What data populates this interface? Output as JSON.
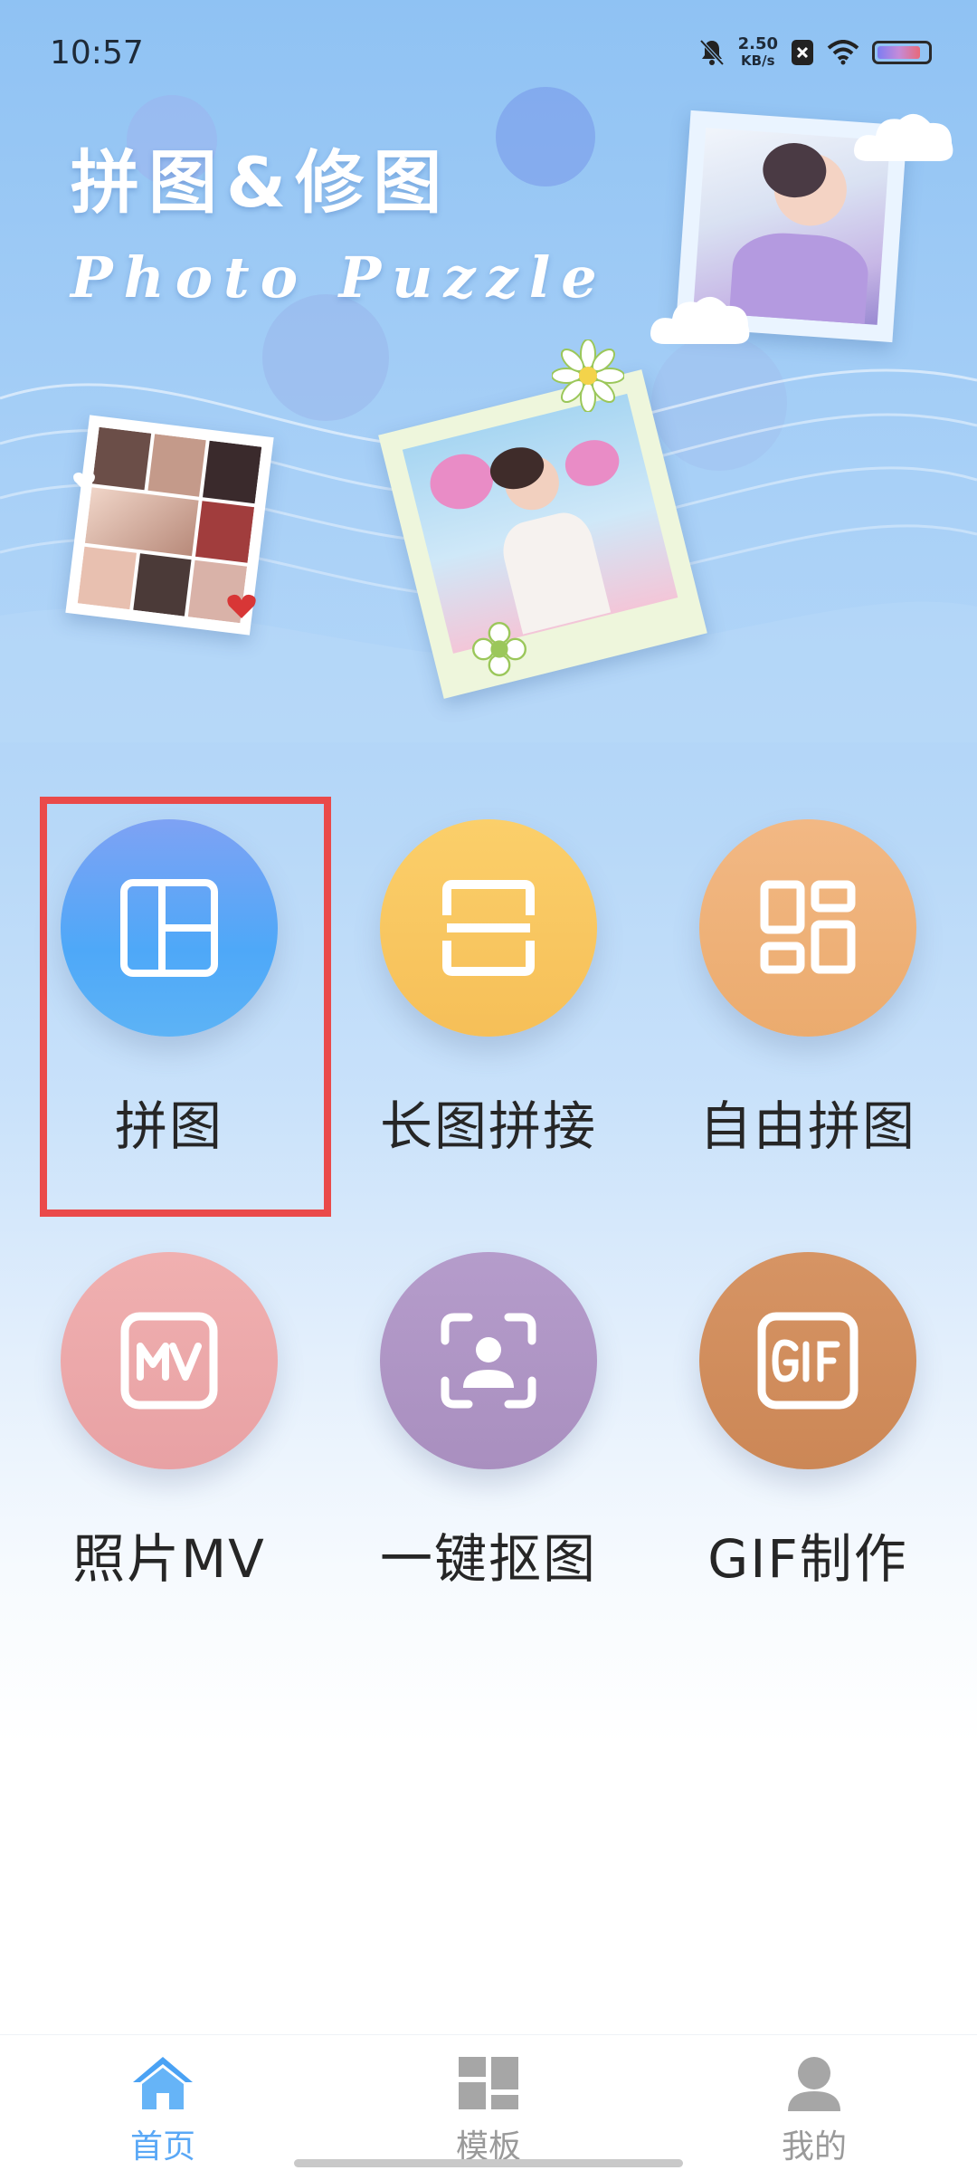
{
  "status_bar": {
    "time": "10:57",
    "net_speed_value": "2.50",
    "net_speed_unit": "KB/s",
    "icons": [
      "bell-muted-icon",
      "x-badge-icon",
      "wifi-icon",
      "battery-icon"
    ]
  },
  "banner": {
    "title": "拼图&修图",
    "subtitle": "Photo Puzzle"
  },
  "features": [
    {
      "label": "拼图",
      "icon": "grid-layout-icon",
      "color": "#5aa8f6"
    },
    {
      "label": "长图拼接",
      "icon": "long-image-stitch-icon",
      "color": "#f6c15c"
    },
    {
      "label": "自由拼图",
      "icon": "free-collage-icon",
      "color": "#efb27a"
    },
    {
      "label": "照片MV",
      "icon": "mv-icon",
      "color": "#eba8a8"
    },
    {
      "label": "一键抠图",
      "icon": "face-scan-icon",
      "color": "#ae94c2"
    },
    {
      "label": "GIF制作",
      "icon": "gif-icon",
      "color": "#d28e5e"
    }
  ],
  "tabs": [
    {
      "label": "首页",
      "icon": "home-icon",
      "active": true,
      "color": "#5aa8f6"
    },
    {
      "label": "模板",
      "icon": "template-icon",
      "active": false,
      "color": "#9a9a9a"
    },
    {
      "label": "我的",
      "icon": "profile-icon",
      "active": false,
      "color": "#9a9a9a"
    }
  ]
}
